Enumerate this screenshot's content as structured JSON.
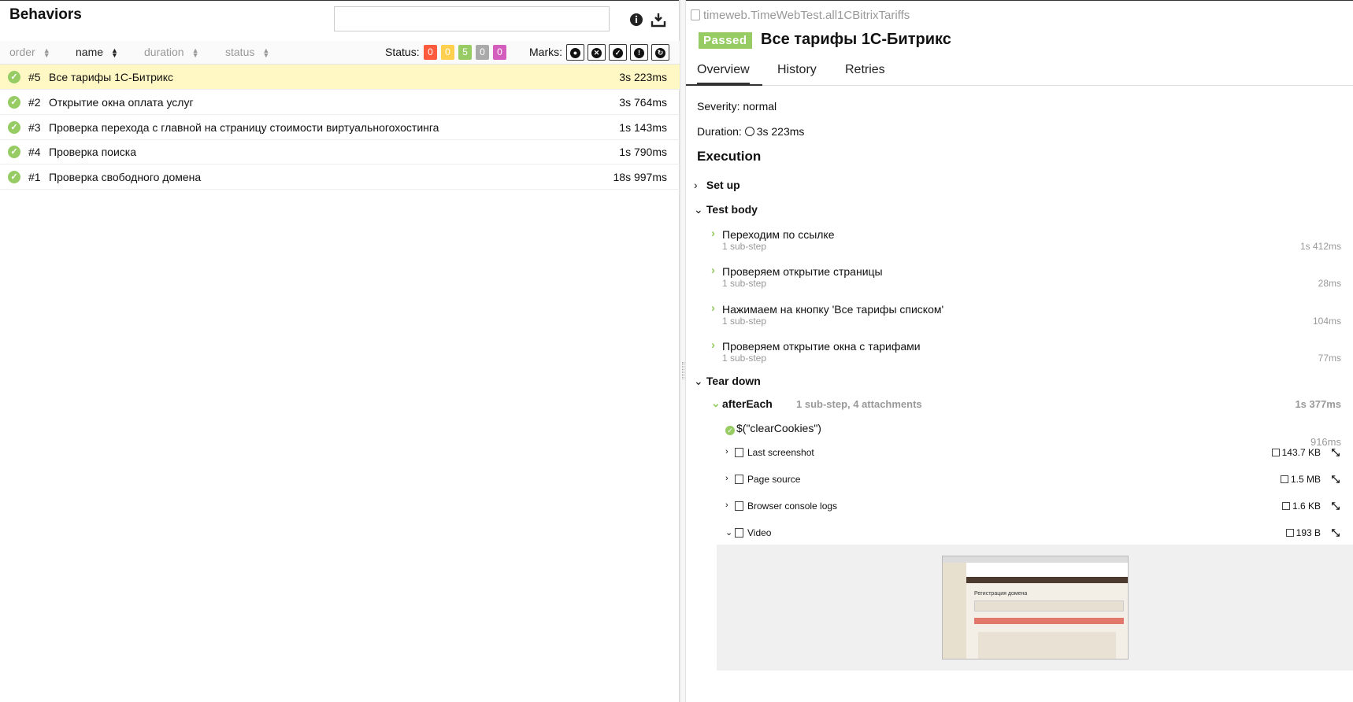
{
  "left": {
    "title": "Behaviors",
    "search": {
      "value": "",
      "placeholder": ""
    },
    "sort": [
      {
        "label": "order",
        "active": false
      },
      {
        "label": "name",
        "active": true
      },
      {
        "label": "duration",
        "active": false
      },
      {
        "label": "status",
        "active": false
      }
    ],
    "status_label": "Status:",
    "counts": [
      {
        "value": "0",
        "color": "#fd5a3e"
      },
      {
        "value": "0",
        "color": "#ffd050"
      },
      {
        "value": "5",
        "color": "#97cc64"
      },
      {
        "value": "0",
        "color": "#aaaaaa"
      },
      {
        "value": "0",
        "color": "#d35ebe"
      }
    ],
    "marks_label": "Marks:",
    "rows": [
      {
        "num": "#5",
        "name": "Все тарифы 1С-Битрикс",
        "duration": "3s 223ms",
        "selected": true
      },
      {
        "num": "#2",
        "name": "Открытие окна оплата услуг",
        "duration": "3s 764ms",
        "selected": false
      },
      {
        "num": "#3",
        "name": "Проверка перехода с главной на страницу стоимости виртуальногохостинга",
        "duration": "1s 143ms",
        "selected": false
      },
      {
        "num": "#4",
        "name": "Проверка поиска",
        "duration": "1s 790ms",
        "selected": false
      },
      {
        "num": "#1",
        "name": "Проверка свободного домена",
        "duration": "18s 997ms",
        "selected": false
      }
    ]
  },
  "right": {
    "uid": "timeweb.TimeWebTest.all1CBitrixTariffs",
    "status": "Passed",
    "title": "Все тарифы 1С-Битрикс",
    "tabs": [
      "Overview",
      "History",
      "Retries"
    ],
    "severity_label": "Severity:",
    "severity": "normal",
    "duration_label": "Duration:",
    "duration": "3s 223ms",
    "execution": "Execution",
    "setup": "Set up",
    "test_body": "Test body",
    "steps": [
      {
        "name": "Переходим по ссылке",
        "sub": "1 sub-step",
        "time": "1s 412ms"
      },
      {
        "name": "Проверяем открытие страницы",
        "sub": "1 sub-step",
        "time": "28ms"
      },
      {
        "name": "Нажимаем на кнопку 'Все тарифы списком'",
        "sub": "1 sub-step",
        "time": "104ms"
      },
      {
        "name": "Проверяем открытие окна с тарифами",
        "sub": "1 sub-step",
        "time": "77ms"
      }
    ],
    "teardown": "Tear down",
    "after_each": {
      "name": "afterEach",
      "info": "1 sub-step, 4 attachments",
      "time": "1s 377ms"
    },
    "clear_cookies": {
      "name": "$(\"clearCookies\")",
      "time": "916ms"
    },
    "attachments": [
      {
        "label": "Last screenshot",
        "size": "143.7 KB",
        "expanded": false
      },
      {
        "label": "Page source",
        "size": "1.5 MB",
        "expanded": false
      },
      {
        "label": "Browser console logs",
        "size": "1.6 KB",
        "expanded": false
      },
      {
        "label": "Video",
        "size": "193 B",
        "expanded": true
      }
    ],
    "video_thumb_text": "Регистрация домена"
  }
}
